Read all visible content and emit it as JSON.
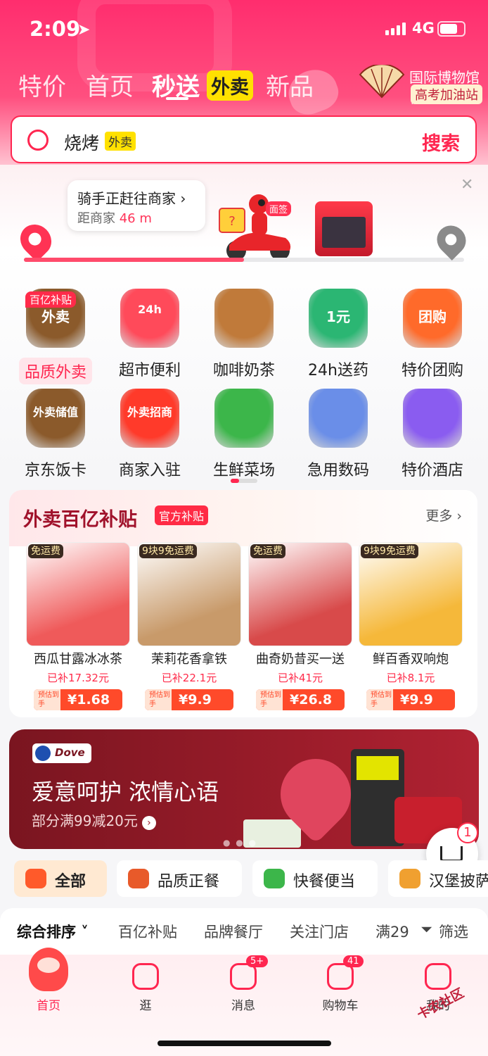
{
  "status": {
    "time": "2:09",
    "network": "4G"
  },
  "tabs": [
    {
      "label": "特价"
    },
    {
      "label": "首页"
    },
    {
      "label": "秒送"
    },
    {
      "label": "新品"
    }
  ],
  "waimai_tag": "外卖",
  "promo": {
    "line1": "国际博物馆日",
    "line2": "高考加油站"
  },
  "search": {
    "value": "烧烤",
    "tag": "外卖",
    "button": "搜索"
  },
  "rider": {
    "status": "骑手正赶往商家",
    "distance_label": "距商家",
    "distance": "46 m",
    "tag": "面签",
    "progress": 0.5
  },
  "grid": [
    {
      "label": "品质外卖",
      "badge": "百亿补贴",
      "icon": "takeout-box-icon",
      "icon_text": "外卖",
      "color": "#8b5a2b"
    },
    {
      "label": "超市便利",
      "badge": "",
      "icon": "store-24h-icon",
      "icon_text": "24h",
      "color": "#ff4a5a"
    },
    {
      "label": "咖啡奶茶",
      "badge": "",
      "icon": "coffee-cup-icon",
      "icon_text": "",
      "color": "#c07a3a"
    },
    {
      "label": "24h送药",
      "badge": "",
      "icon": "medicine-box-icon",
      "icon_text": "1元",
      "color": "#2bb673"
    },
    {
      "label": "特价团购",
      "badge": "",
      "icon": "group-buy-ticket-icon",
      "icon_text": "团购",
      "color": "#ff6a2a"
    },
    {
      "label": "京东饭卡",
      "badge": "",
      "icon": "meal-card-icon",
      "icon_text": "外卖储值",
      "color": "#8b5a2b"
    },
    {
      "label": "商家入驻",
      "badge": "",
      "icon": "merchant-join-icon",
      "icon_text": "外卖招商",
      "color": "#ff3a2a"
    },
    {
      "label": "生鲜菜场",
      "badge": "",
      "icon": "broccoli-icon",
      "icon_text": "",
      "color": "#3cb64a"
    },
    {
      "label": "急用数码",
      "badge": "",
      "icon": "phone-cable-icon",
      "icon_text": "",
      "color": "#6a8ee8"
    },
    {
      "label": "特价酒店",
      "badge": "",
      "icon": "hotel-building-icon",
      "icon_text": "",
      "color": "#8a5cf0"
    }
  ],
  "subsidy": {
    "title": "外卖百亿补贴",
    "tag": "官方补贴",
    "more": "更多 ›",
    "price_label": "预估到手",
    "products": [
      {
        "name": "西瓜甘露冰冰茶",
        "flag": "免运费",
        "subsidy": "已补17.32元",
        "price": "¥1.68",
        "color": "#ef5a5a"
      },
      {
        "name": "茉莉花香拿铁",
        "flag": "9块9免运费",
        "subsidy": "已补22.1元",
        "price": "¥9.9",
        "color": "#c89a6a"
      },
      {
        "name": "曲奇奶昔买一送",
        "flag": "免运费",
        "subsidy": "已补41元",
        "price": "¥26.8",
        "color": "#d84a4a"
      },
      {
        "name": "鲜百香双响炮",
        "flag": "9块9免运费",
        "subsidy": "已补8.1元",
        "price": "¥9.9",
        "color": "#f5b83a"
      }
    ]
  },
  "ad": {
    "brand": "Dove",
    "headline": "爱意呵护 浓情心语",
    "sub": "部分满99减20元"
  },
  "cart_count": "1",
  "categories": [
    {
      "label": "全部",
      "icon": "food-tag-icon",
      "color": "#ff5a2a"
    },
    {
      "label": "品质正餐",
      "icon": "meal-bowl-icon",
      "color": "#e85a2a"
    },
    {
      "label": "快餐便当",
      "icon": "bento-icon",
      "color": "#3cb64a"
    },
    {
      "label": "汉堡披萨",
      "icon": "burger-icon",
      "color": "#f0a030"
    }
  ],
  "sort": [
    {
      "label": "综合排序 ˅"
    },
    {
      "label": "百亿补贴"
    },
    {
      "label": "品牌餐厅"
    },
    {
      "label": "关注门店"
    },
    {
      "label": "满29"
    },
    {
      "label": "筛选"
    }
  ],
  "nav": [
    {
      "label": "首页",
      "badge": ""
    },
    {
      "label": "逛",
      "badge": ""
    },
    {
      "label": "消息",
      "badge": "5+"
    },
    {
      "label": "购物车",
      "badge": "41"
    },
    {
      "label": "我的",
      "badge": ""
    }
  ],
  "watermark": "卡农社区"
}
